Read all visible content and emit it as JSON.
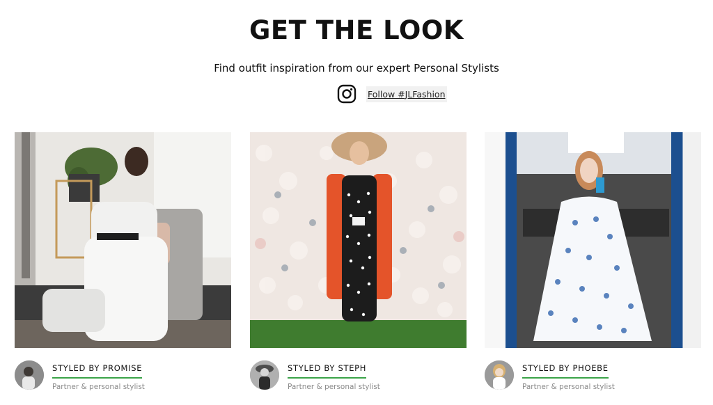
{
  "header": {
    "title": "GET THE LOOK",
    "subtitle": "Find outfit inspiration from our expert Personal Stylists",
    "follow_label": "Follow #JLFashion",
    "follow_icon": "instagram-icon"
  },
  "stylists": [
    {
      "name": "STYLED BY PROMISE",
      "role": "Partner & personal stylist"
    },
    {
      "name": "STYLED BY STEPH",
      "role": "Partner & personal stylist"
    },
    {
      "name": "STYLED BY PHOEBE",
      "role": "Partner & personal stylist"
    }
  ],
  "colors": {
    "accent_underline": "#3aa348",
    "text": "#111111",
    "muted": "#8a8a8a"
  }
}
